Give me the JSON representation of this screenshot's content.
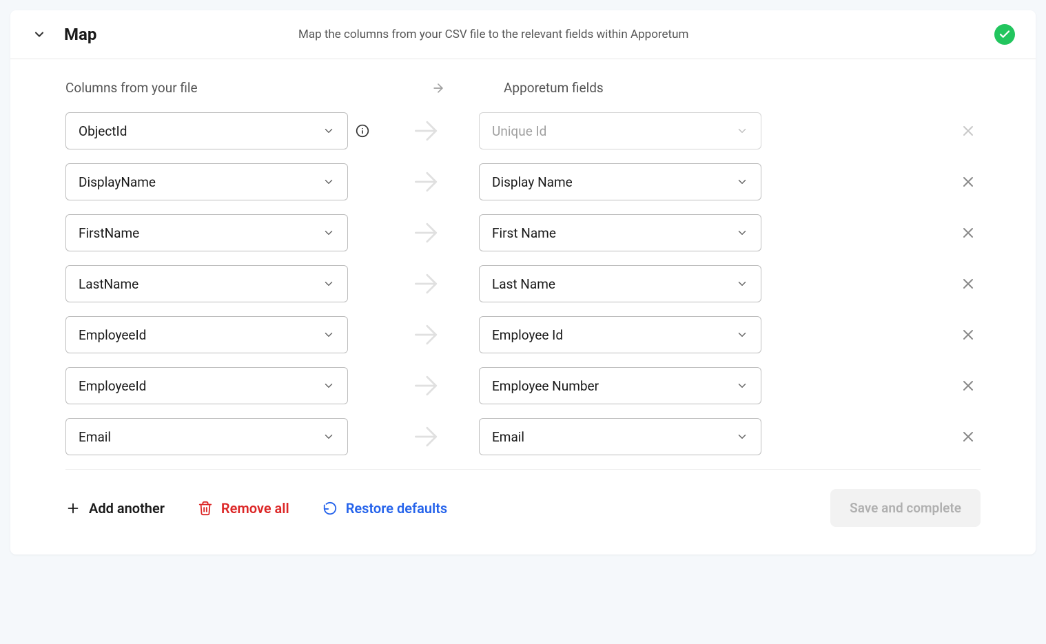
{
  "header": {
    "title": "Map",
    "subtitle": "Map the columns from your CSV file to the relevant fields within Apporetum"
  },
  "columns": {
    "left_header": "Columns from your file",
    "right_header": "Apporetum fields"
  },
  "mappings": [
    {
      "source": "ObjectId",
      "target": "Unique Id",
      "target_disabled": true,
      "has_info": true,
      "removable": false
    },
    {
      "source": "DisplayName",
      "target": "Display Name",
      "target_disabled": false,
      "has_info": false,
      "removable": true
    },
    {
      "source": "FirstName",
      "target": "First Name",
      "target_disabled": false,
      "has_info": false,
      "removable": true
    },
    {
      "source": "LastName",
      "target": "Last Name",
      "target_disabled": false,
      "has_info": false,
      "removable": true
    },
    {
      "source": "EmployeeId",
      "target": "Employee Id",
      "target_disabled": false,
      "has_info": false,
      "removable": true
    },
    {
      "source": "EmployeeId",
      "target": "Employee Number",
      "target_disabled": false,
      "has_info": false,
      "removable": true
    },
    {
      "source": "Email",
      "target": "Email",
      "target_disabled": false,
      "has_info": false,
      "removable": true
    }
  ],
  "footer": {
    "add": "Add another",
    "remove": "Remove all",
    "restore": "Restore defaults",
    "save": "Save and complete"
  }
}
